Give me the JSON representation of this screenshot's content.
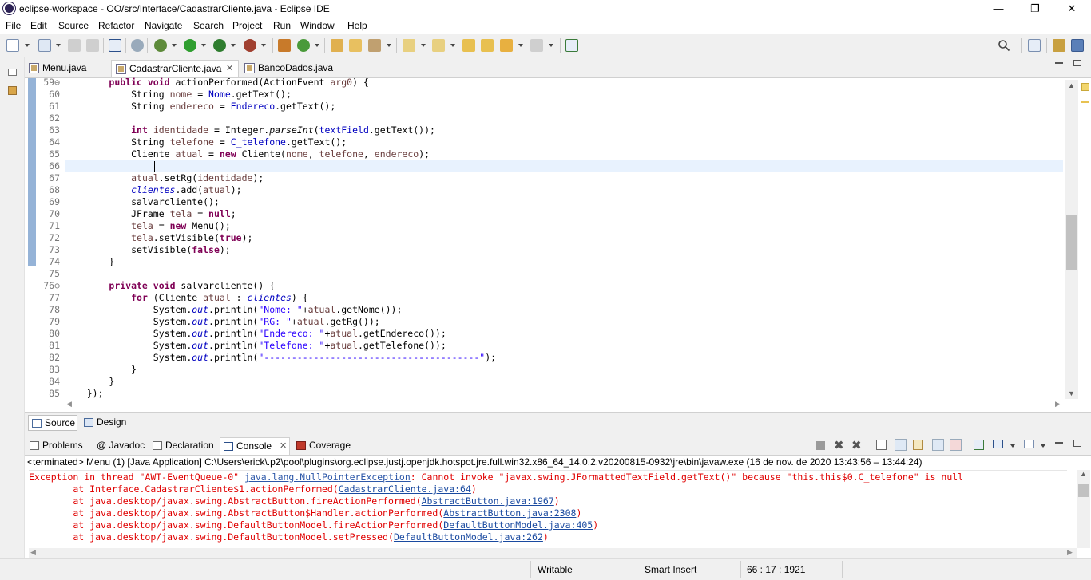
{
  "window": {
    "title": "eclipse-workspace - OO/src/Interface/CadastrarCliente.java - Eclipse IDE",
    "minimize": "—",
    "restore": "❐",
    "close": "✕"
  },
  "menu": [
    "File",
    "Edit",
    "Source",
    "Refactor",
    "Navigate",
    "Search",
    "Project",
    "Run",
    "Window",
    "Help"
  ],
  "editor_tabs": [
    {
      "label": "Menu.java",
      "active": false
    },
    {
      "label": "CadastrarCliente.java",
      "active": true,
      "close": "✕"
    },
    {
      "label": "BancoDados.java",
      "active": false
    }
  ],
  "editor": {
    "line_numbers": [
      "59⊖",
      "60",
      "61",
      "62",
      "63",
      "64",
      "65",
      "66",
      "67",
      "68",
      "69",
      "70",
      "71",
      "72",
      "73",
      "74",
      "75",
      "76⊖",
      "77",
      "78",
      "79",
      "80",
      "81",
      "82",
      "83",
      "84",
      "85"
    ],
    "code": [
      [
        {
          "t": "        "
        },
        {
          "t": "public",
          "c": "kw"
        },
        {
          "t": " "
        },
        {
          "t": "void",
          "c": "kw"
        },
        {
          "t": " actionPerformed(ActionEvent "
        },
        {
          "t": "arg0",
          "c": "loc"
        },
        {
          "t": ") {"
        }
      ],
      [
        {
          "t": "            String "
        },
        {
          "t": "nome",
          "c": "loc"
        },
        {
          "t": " = "
        },
        {
          "t": "Nome",
          "c": "fld"
        },
        {
          "t": ".getText();"
        }
      ],
      [
        {
          "t": "            String "
        },
        {
          "t": "endereco",
          "c": "loc"
        },
        {
          "t": " = "
        },
        {
          "t": "Endereco",
          "c": "fld"
        },
        {
          "t": ".getText();"
        }
      ],
      [
        {
          "t": ""
        }
      ],
      [
        {
          "t": "            "
        },
        {
          "t": "int",
          "c": "kw"
        },
        {
          "t": " "
        },
        {
          "t": "identidade",
          "c": "loc"
        },
        {
          "t": " = Integer."
        },
        {
          "t": "parseInt",
          "c": "it"
        },
        {
          "t": "("
        },
        {
          "t": "textField",
          "c": "fld"
        },
        {
          "t": ".getText());"
        }
      ],
      [
        {
          "t": "            String "
        },
        {
          "t": "telefone",
          "c": "loc"
        },
        {
          "t": " = "
        },
        {
          "t": "C_telefone",
          "c": "fld"
        },
        {
          "t": ".getText();"
        }
      ],
      [
        {
          "t": "            Cliente "
        },
        {
          "t": "atual",
          "c": "loc"
        },
        {
          "t": " = "
        },
        {
          "t": "new",
          "c": "kw"
        },
        {
          "t": " Cliente("
        },
        {
          "t": "nome",
          "c": "loc"
        },
        {
          "t": ", "
        },
        {
          "t": "telefone",
          "c": "loc"
        },
        {
          "t": ", "
        },
        {
          "t": "endereco",
          "c": "loc"
        },
        {
          "t": ");"
        }
      ],
      [
        {
          "t": "            "
        }
      ],
      [
        {
          "t": "            "
        },
        {
          "t": "atual",
          "c": "loc"
        },
        {
          "t": ".setRg("
        },
        {
          "t": "identidade",
          "c": "loc"
        },
        {
          "t": ");"
        }
      ],
      [
        {
          "t": "            "
        },
        {
          "t": "clientes",
          "c": "sf"
        },
        {
          "t": ".add("
        },
        {
          "t": "atual",
          "c": "loc"
        },
        {
          "t": ");"
        }
      ],
      [
        {
          "t": "            salvarcliente();"
        }
      ],
      [
        {
          "t": "            JFrame "
        },
        {
          "t": "tela",
          "c": "loc"
        },
        {
          "t": " = "
        },
        {
          "t": "null",
          "c": "kw"
        },
        {
          "t": ";"
        }
      ],
      [
        {
          "t": "            "
        },
        {
          "t": "tela",
          "c": "loc"
        },
        {
          "t": " = "
        },
        {
          "t": "new",
          "c": "kw"
        },
        {
          "t": " Menu();"
        }
      ],
      [
        {
          "t": "            "
        },
        {
          "t": "tela",
          "c": "loc"
        },
        {
          "t": ".setVisible("
        },
        {
          "t": "true",
          "c": "kw"
        },
        {
          "t": ");"
        }
      ],
      [
        {
          "t": "            setVisible("
        },
        {
          "t": "false",
          "c": "kw"
        },
        {
          "t": ");"
        }
      ],
      [
        {
          "t": "        }"
        }
      ],
      [
        {
          "t": ""
        }
      ],
      [
        {
          "t": "        "
        },
        {
          "t": "private",
          "c": "kw"
        },
        {
          "t": " "
        },
        {
          "t": "void",
          "c": "kw"
        },
        {
          "t": " salvarcliente() {"
        }
      ],
      [
        {
          "t": "            "
        },
        {
          "t": "for",
          "c": "kw"
        },
        {
          "t": " (Cliente "
        },
        {
          "t": "atual",
          "c": "loc"
        },
        {
          "t": " : "
        },
        {
          "t": "clientes",
          "c": "sf"
        },
        {
          "t": ") {"
        }
      ],
      [
        {
          "t": "                System."
        },
        {
          "t": "out",
          "c": "sf"
        },
        {
          "t": ".println("
        },
        {
          "t": "\"Nome: \"",
          "c": "st"
        },
        {
          "t": "+"
        },
        {
          "t": "atual",
          "c": "loc"
        },
        {
          "t": ".getNome());"
        }
      ],
      [
        {
          "t": "                System."
        },
        {
          "t": "out",
          "c": "sf"
        },
        {
          "t": ".println("
        },
        {
          "t": "\"RG: \"",
          "c": "st"
        },
        {
          "t": "+"
        },
        {
          "t": "atual",
          "c": "loc"
        },
        {
          "t": ".getRg());"
        }
      ],
      [
        {
          "t": "                System."
        },
        {
          "t": "out",
          "c": "sf"
        },
        {
          "t": ".println("
        },
        {
          "t": "\"Endereco: \"",
          "c": "st"
        },
        {
          "t": "+"
        },
        {
          "t": "atual",
          "c": "loc"
        },
        {
          "t": ".getEndereco());"
        }
      ],
      [
        {
          "t": "                System."
        },
        {
          "t": "out",
          "c": "sf"
        },
        {
          "t": ".println("
        },
        {
          "t": "\"Telefone: \"",
          "c": "st"
        },
        {
          "t": "+"
        },
        {
          "t": "atual",
          "c": "loc"
        },
        {
          "t": ".getTelefone());"
        }
      ],
      [
        {
          "t": "                System."
        },
        {
          "t": "out",
          "c": "sf"
        },
        {
          "t": ".println("
        },
        {
          "t": "\"---------------------------------------\"",
          "c": "st"
        },
        {
          "t": ");"
        }
      ],
      [
        {
          "t": "            }"
        }
      ],
      [
        {
          "t": "        }"
        }
      ],
      [
        {
          "t": "    });"
        }
      ]
    ]
  },
  "source_design_tabs": [
    {
      "label": "Source",
      "active": true
    },
    {
      "label": "Design",
      "active": false
    }
  ],
  "view_tabs": [
    {
      "label": "Problems",
      "active": false
    },
    {
      "label": "Javadoc",
      "active": false,
      "prefix": "@"
    },
    {
      "label": "Declaration",
      "active": false
    },
    {
      "label": "Console",
      "active": true,
      "close": "✕"
    },
    {
      "label": "Coverage",
      "active": false
    }
  ],
  "console": {
    "status": "<terminated> Menu (1) [Java Application] C:\\Users\\erick\\.p2\\pool\\plugins\\org.eclipse.justj.openjdk.hotspot.jre.full.win32.x86_64_14.0.2.v20200815-0932\\jre\\bin\\javaw.exe  (16 de nov. de 2020 13:43:56 – 13:44:24)",
    "lines": [
      [
        {
          "t": "Exception in thread \"AWT-EventQueue-0\" "
        },
        {
          "t": "java.lang.NullPointerException",
          "c": "lnk"
        },
        {
          "t": ": Cannot invoke \"javax.swing.JFormattedTextField.getText()\" because \"this.this$0.C_telefone\" is null"
        }
      ],
      [
        {
          "t": "\tat Interface.CadastrarCliente$1.actionPerformed("
        },
        {
          "t": "CadastrarCliente.java:64",
          "c": "lnk2"
        },
        {
          "t": ")"
        }
      ],
      [
        {
          "t": "\tat java.desktop/javax.swing.AbstractButton.fireActionPerformed("
        },
        {
          "t": "AbstractButton.java:1967",
          "c": "lnk2"
        },
        {
          "t": ")"
        }
      ],
      [
        {
          "t": "\tat java.desktop/javax.swing.AbstractButton$Handler.actionPerformed("
        },
        {
          "t": "AbstractButton.java:2308",
          "c": "lnk2"
        },
        {
          "t": ")"
        }
      ],
      [
        {
          "t": "\tat java.desktop/javax.swing.DefaultButtonModel.fireActionPerformed("
        },
        {
          "t": "DefaultButtonModel.java:405",
          "c": "lnk2"
        },
        {
          "t": ")"
        }
      ],
      [
        {
          "t": "\tat java.desktop/javax.swing.DefaultButtonModel.setPressed("
        },
        {
          "t": "DefaultButtonModel.java:262",
          "c": "lnk2"
        },
        {
          "t": ")"
        }
      ]
    ]
  },
  "statusbar": {
    "writable": "Writable",
    "insert_mode": "Smart Insert",
    "position": "66 : 17 : 1921"
  }
}
